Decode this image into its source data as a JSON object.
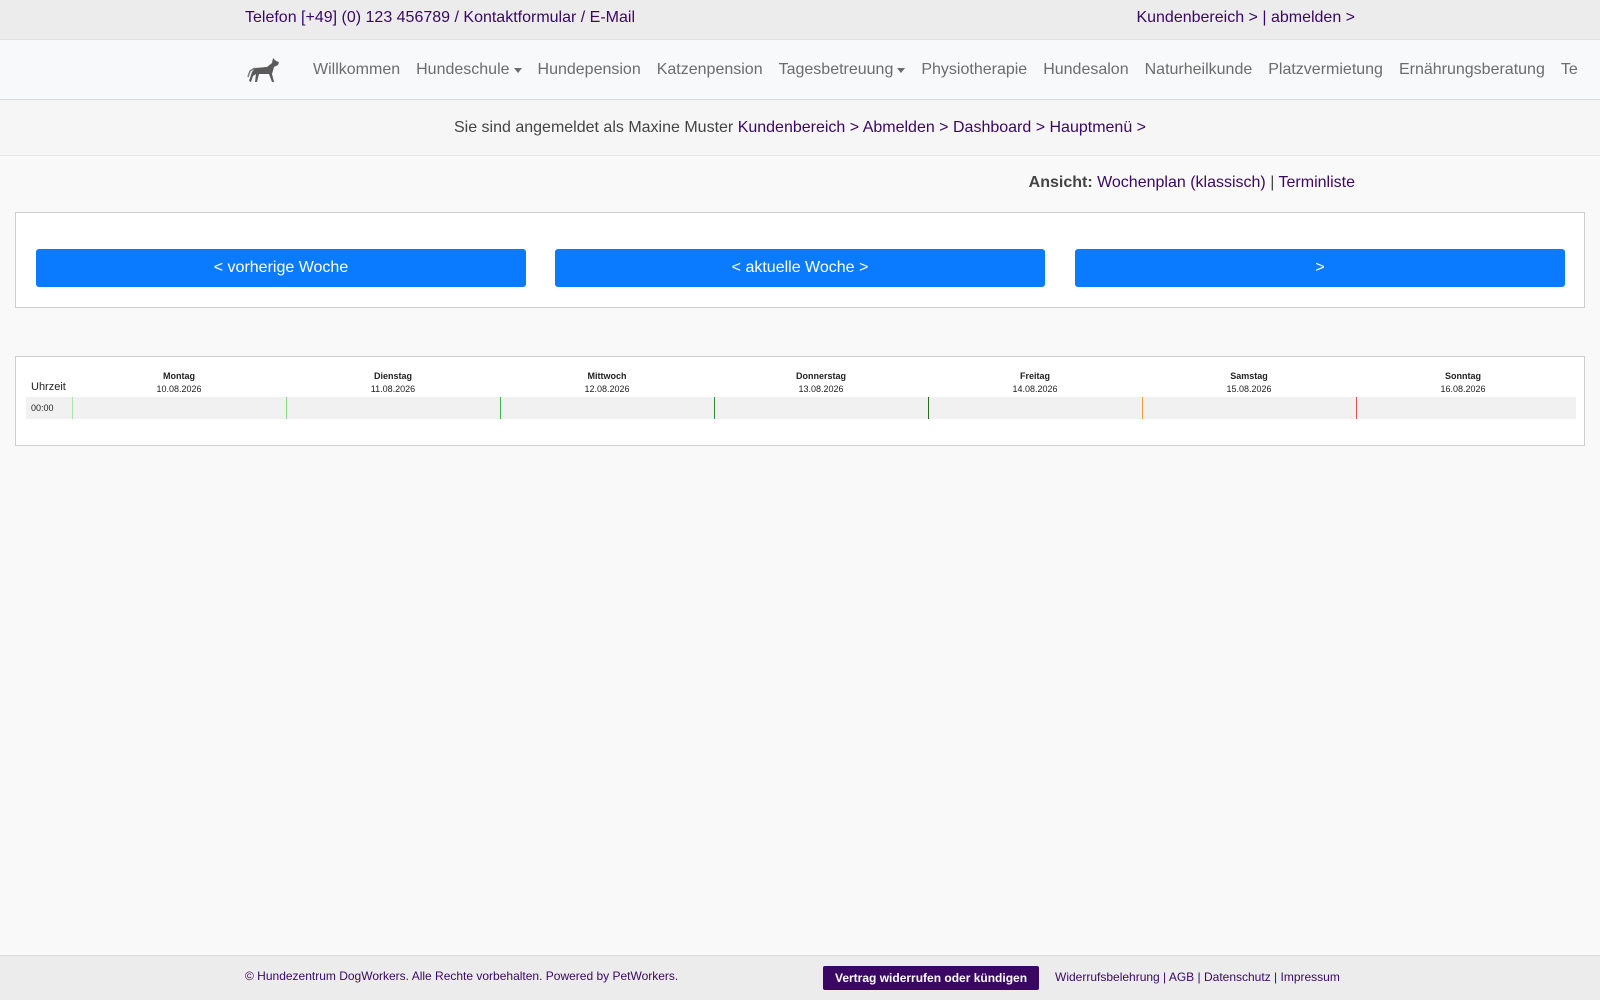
{
  "topbar": {
    "phone": "Telefon [+49] (0) 123 456789",
    "sep1": " / ",
    "contact_form": "Kontaktformular",
    "sep2": " / ",
    "email": "E-Mail",
    "customer_area": "Kundenbereich >",
    "sep3": " | ",
    "logout": "abmelden >"
  },
  "nav": {
    "items": [
      {
        "label": "Willkommen",
        "dropdown": false
      },
      {
        "label": "Hundeschule",
        "dropdown": true
      },
      {
        "label": "Hundepension",
        "dropdown": false
      },
      {
        "label": "Katzenpension",
        "dropdown": false
      },
      {
        "label": "Tagesbetreuung",
        "dropdown": true
      },
      {
        "label": "Physiotherapie",
        "dropdown": false
      },
      {
        "label": "Hundesalon",
        "dropdown": false
      },
      {
        "label": "Naturheilkunde",
        "dropdown": false
      },
      {
        "label": "Platzvermietung",
        "dropdown": false
      },
      {
        "label": "Ernährungsberatung",
        "dropdown": false
      },
      {
        "label": "Te",
        "dropdown": false
      }
    ]
  },
  "login": {
    "prefix": "Sie sind angemeldet als Maxine Muster ",
    "customer_area": "Kundenbereich >",
    "logout": "Abmelden >",
    "dashboard": "Dashboard >",
    "main_menu": "Hauptmenü >"
  },
  "view": {
    "label": "Ansicht:",
    "weekplan": "Wochenplan (klassisch)",
    "sep": " | ",
    "list": "Terminliste"
  },
  "week_nav": {
    "prev": "< vorherige Woche",
    "current": "< aktuelle Woche >",
    "next": ">"
  },
  "calendar": {
    "time_header": "Uhrzeit",
    "days": [
      {
        "name": "Montag",
        "date": "10.08.2026",
        "color": "#a8e6a8"
      },
      {
        "name": "Dienstag",
        "date": "11.08.2026",
        "color": "#86d986"
      },
      {
        "name": "Mittwoch",
        "date": "12.08.2026",
        "color": "#4cae4c"
      },
      {
        "name": "Donnerstag",
        "date": "13.08.2026",
        "color": "#2e8b2e"
      },
      {
        "name": "Freitag",
        "date": "14.08.2026",
        "color": "#1f6b1f"
      },
      {
        "name": "Samstag",
        "date": "15.08.2026",
        "color": "#f0a040"
      },
      {
        "name": "Sonntag",
        "date": "16.08.2026",
        "color": "#e05050"
      }
    ],
    "rows": [
      "00:00"
    ]
  },
  "footer": {
    "copyright": "© Hundezentrum DogWorkers. Alle Rechte vorbehalten. Powered by PetWorkers.",
    "cancel_button": "Vertrag widerrufen oder kündigen",
    "widerruf": "Widerrufsbelehrung",
    "sep1": " | ",
    "agb": "AGB",
    "sep2": " | ",
    "privacy": "Datenschutz",
    "sep3": " | ",
    "imprint": "Impressum"
  },
  "colors": {
    "accent_button": "#0a7bff",
    "link": "#3b0764",
    "dark_button": "#3b0764"
  },
  "icons": {
    "brand": "dog-logo-icon",
    "dropdown": "caret-down-icon"
  }
}
